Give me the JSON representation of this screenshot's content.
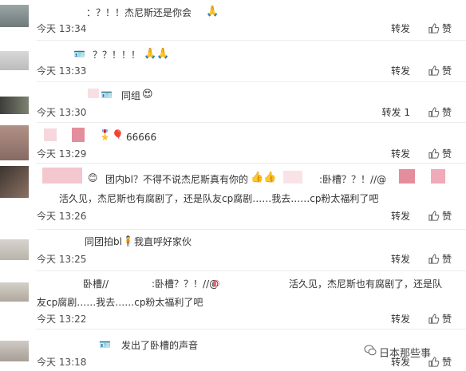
{
  "comments": [
    {
      "text": "：？！！杰尼斯还是你会",
      "emoji": "🙏",
      "time": "今天 13:34",
      "repost": "转发",
      "like": "赞"
    },
    {
      "text": "？？！！！",
      "emoji": "🙏🙏",
      "time": "今天 13:33",
      "repost": "转发",
      "like": "赞"
    },
    {
      "text": "同组",
      "emoji": "😍",
      "time": "今天 13:30",
      "repost": "转发 1",
      "like": "赞"
    },
    {
      "text": "66666",
      "time": "今天 13:29",
      "repost": "转发",
      "like": "赞"
    },
    {
      "text": "团内bl？不得不说杰尼斯真有你的",
      "text_b": ":卧槽？？！//@",
      "text_c": "活久见，杰尼斯也有腐剧了，还是队友cp腐剧……我去……cp粉太福利了吧",
      "emoji": "👍👍",
      "time": "今天 13:26",
      "repost": "转发",
      "like": "赞"
    },
    {
      "text": "同团拍bl",
      "text_b": "我直呼好家伙",
      "time": "今天 13:25",
      "repost": "转发",
      "like": "赞"
    },
    {
      "text": "卧槽//",
      "text_b": ":卧槽？？！//@",
      "text_c": "活久见，杰尼斯也有腐剧了，还是队",
      "text_d": "友cp腐剧……我去……cp粉太福利了吧",
      "time": "今天 13:22",
      "repost": "转发",
      "like": "赞"
    },
    {
      "text": "发出了卧槽的声音",
      "time": "今天 13:18",
      "repost": "转发",
      "like": "赞"
    }
  ],
  "watermark": "日本那些事",
  "colors": {
    "pink": "#f4c6cf",
    "pink_dark": "#e48d9c",
    "divider": "#ececec"
  }
}
